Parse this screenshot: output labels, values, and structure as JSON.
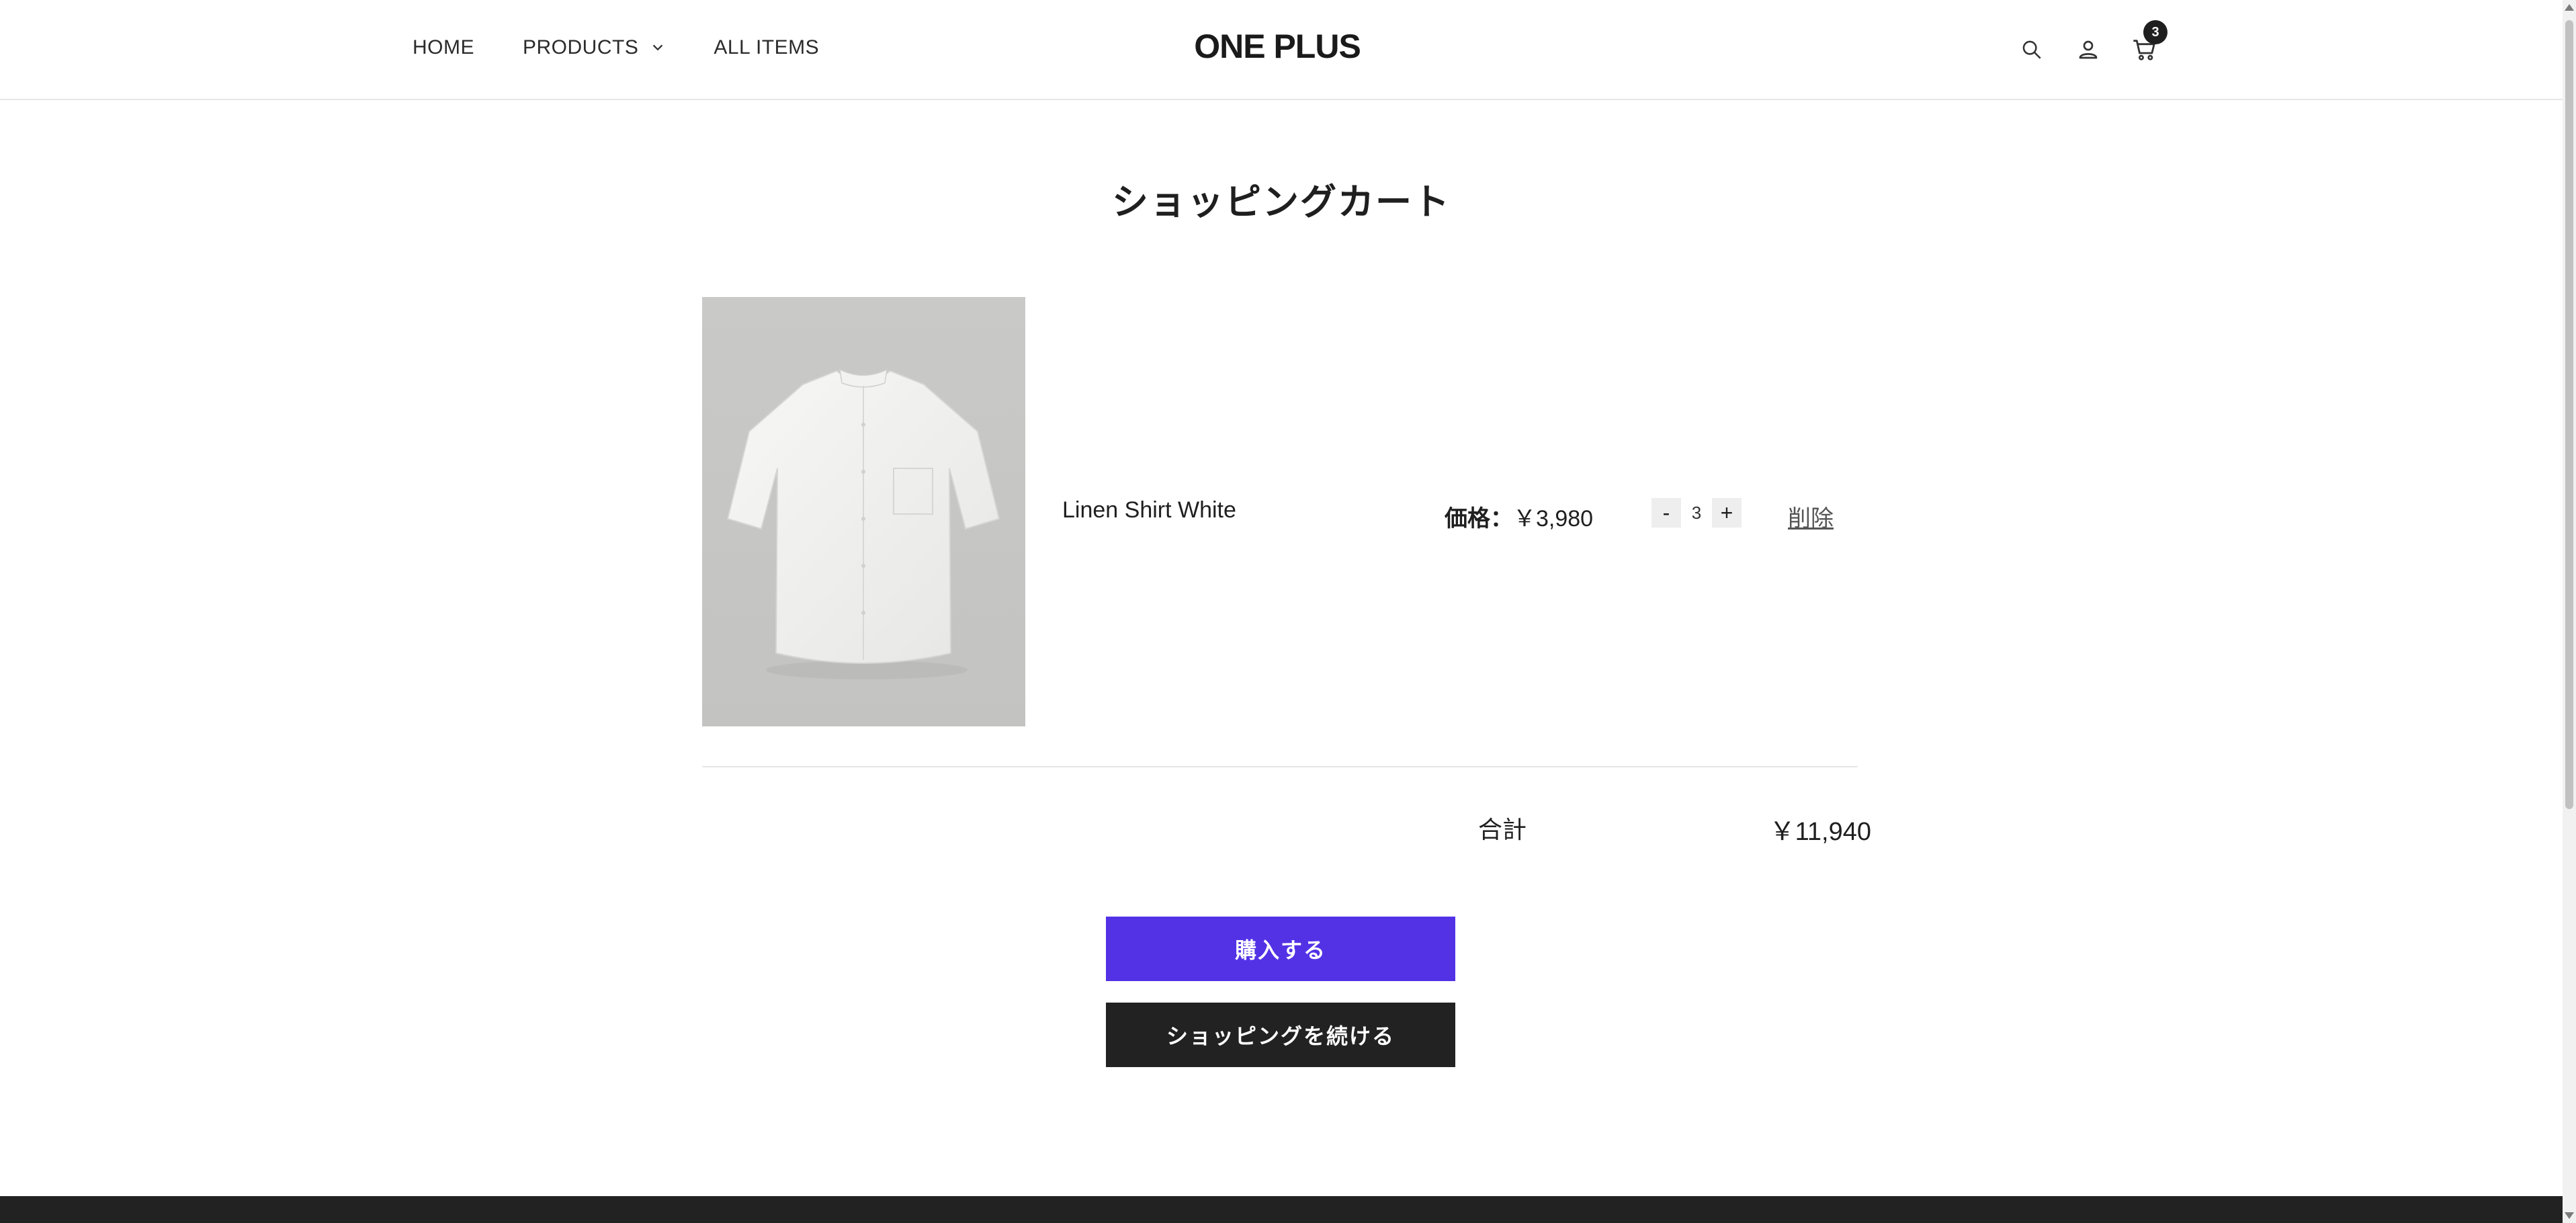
{
  "header": {
    "nav": {
      "home": "HOME",
      "products": "PRODUCTS",
      "all_items": "ALL ITEMS"
    },
    "logo": "ONE PLUS",
    "cart_count": "3"
  },
  "main": {
    "title": "ショッピングカート",
    "items": [
      {
        "name": "Linen Shirt White",
        "price_label": "価格：",
        "price": "￥3,980",
        "quantity": "3",
        "decrement": "-",
        "increment": "+",
        "remove_label": "削除"
      }
    ],
    "total_label": "合計",
    "total_value": "￥11,940",
    "buy_button": "購入する",
    "continue_button": "ショッピングを続ける"
  },
  "colors": {
    "accent": "#5332e6",
    "dark": "#222222"
  }
}
